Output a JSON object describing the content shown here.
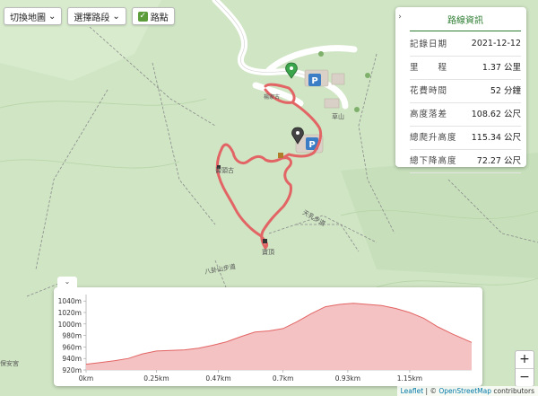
{
  "toolbar": {
    "switch_map": "切換地圖",
    "select_segment": "選擇路段",
    "waypoint": "路點",
    "waypoint_checked": true
  },
  "info_panel": {
    "title": "路線資訊",
    "collapse_icon": "chevron-right-icon",
    "rows": [
      {
        "key": "記錄日期",
        "value": "2021-12-12"
      },
      {
        "key": "里　　程",
        "value": "1.37 公里"
      },
      {
        "key": "花費時間",
        "value": "52 分鐘"
      },
      {
        "key": "高度落差",
        "value": "108.62 公尺"
      },
      {
        "key": "總爬升高度",
        "value": "115.34 公尺"
      },
      {
        "key": "總下降高度",
        "value": "72.27 公尺"
      }
    ]
  },
  "map_labels": {
    "yangjia": "楊家古",
    "luntou": "崙頭古",
    "baoding": "寶頂",
    "tianru": "天乳步道",
    "baguashan": "八卦山步道",
    "baoan": "保安宮",
    "caoshan": "草山"
  },
  "route_color": "#e36464",
  "elevation": {
    "collapse_icon": "chevron-down-icon",
    "chart_data": {
      "type": "area",
      "y_ticks": [
        "1040m",
        "1020m",
        "1000m",
        "980m",
        "960m",
        "940m",
        "920m"
      ],
      "x_ticks": [
        "0km",
        "0.25km",
        "0.47km",
        "0.7km",
        "0.93km",
        "1.15km"
      ],
      "ylim": [
        920,
        1045
      ],
      "xlim": [
        0,
        1.37
      ],
      "x": [
        0,
        0.05,
        0.1,
        0.15,
        0.2,
        0.25,
        0.3,
        0.35,
        0.4,
        0.45,
        0.5,
        0.55,
        0.6,
        0.65,
        0.7,
        0.75,
        0.8,
        0.85,
        0.9,
        0.95,
        1.0,
        1.05,
        1.1,
        1.15,
        1.2,
        1.25,
        1.3,
        1.37
      ],
      "y": [
        930,
        933,
        936,
        940,
        948,
        953,
        954,
        955,
        958,
        963,
        969,
        978,
        986,
        988,
        992,
        1004,
        1018,
        1030,
        1034,
        1036,
        1034,
        1032,
        1027,
        1020,
        1010,
        995,
        983,
        968
      ],
      "fill": "#f4c2c2",
      "stroke": "#e36464"
    }
  },
  "zoom": {
    "in": "+",
    "out": "−"
  },
  "attribution": {
    "leaflet": "Leaflet",
    "sep": " | © ",
    "osm": "OpenStreetMap",
    "rest": " contributors"
  }
}
